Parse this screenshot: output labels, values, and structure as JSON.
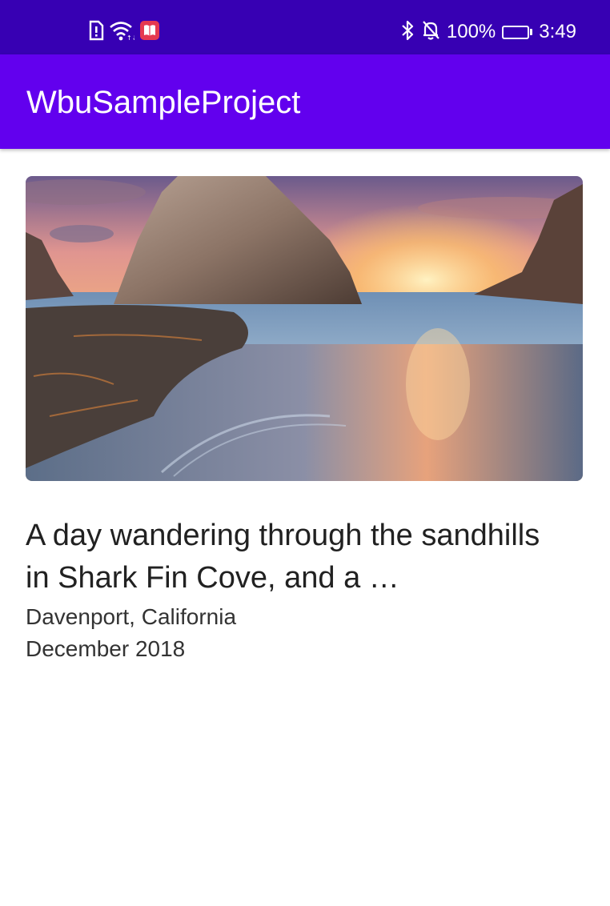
{
  "status_bar": {
    "left_icons": [
      "sim-alert-icon",
      "wifi-icon",
      "notification-app-icon"
    ],
    "right_icons": [
      "bluetooth-icon",
      "bell-off-icon",
      "battery-icon"
    ],
    "battery_text": "100%",
    "battery_level": 1.0,
    "time": "3:49",
    "background": "#3700b3"
  },
  "app_bar": {
    "title": "WbuSampleProject",
    "background": "#6200ee"
  },
  "post": {
    "image": "sea-stack-sunset-cove-photo",
    "title": "A day wandering through the sandhills in Shark Fin Cove, and a …",
    "location": "Davenport, California",
    "date": "December 2018"
  }
}
